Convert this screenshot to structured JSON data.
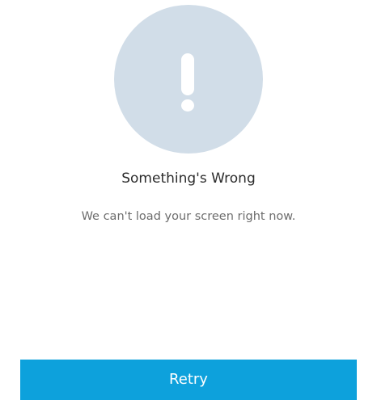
{
  "error": {
    "icon": "exclamation-icon",
    "title": "Something's Wrong",
    "message": "We can't load your screen right now."
  },
  "actions": {
    "retry_label": "Retry"
  },
  "colors": {
    "background": "#ffffff",
    "illustration": "#d1dde8",
    "title_text": "#2b2b2b",
    "message_text": "#6d6d6d",
    "button": "#0da1dc",
    "button_text": "#ffffff"
  }
}
